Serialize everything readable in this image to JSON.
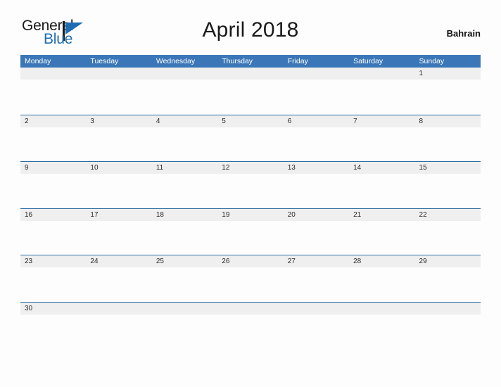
{
  "brand": {
    "name_part1": "General",
    "name_part2": "Blue",
    "mark": "triangle-flag-icon",
    "color_primary": "#1f6cb0",
    "color_text": "#1a1a1a"
  },
  "header": {
    "title": "April 2018",
    "country": "Bahrain"
  },
  "calendar": {
    "colors": {
      "header_band": "#3b77b8",
      "day_band": "#efefef",
      "rule": "#2e6da4",
      "page_background": "#fdfdfd"
    },
    "weekdays": [
      "Monday",
      "Tuesday",
      "Wednesday",
      "Thursday",
      "Friday",
      "Saturday",
      "Sunday"
    ],
    "weeks": [
      [
        "",
        "",
        "",
        "",
        "",
        "",
        "1"
      ],
      [
        "2",
        "3",
        "4",
        "5",
        "6",
        "7",
        "8"
      ],
      [
        "9",
        "10",
        "11",
        "12",
        "13",
        "14",
        "15"
      ],
      [
        "16",
        "17",
        "18",
        "19",
        "20",
        "21",
        "22"
      ],
      [
        "23",
        "24",
        "25",
        "26",
        "27",
        "28",
        "29"
      ],
      [
        "30",
        "",
        "",
        "",
        "",
        "",
        ""
      ]
    ]
  }
}
